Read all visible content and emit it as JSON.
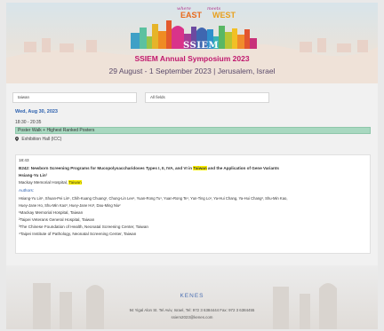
{
  "banner": {
    "where": "where",
    "meets": "meets",
    "east": "EAST",
    "west": "WEST",
    "logo": "SSIEM",
    "title": "SSIEM Annual Symposium 2023",
    "dates": "29 August - 1 September 2023 | Jerusalem, Israel"
  },
  "search": {
    "keyword_value": "taiwan",
    "filter_value": "All fields"
  },
  "session": {
    "date": "Wed, Aug 30, 2023",
    "time": "18:30 - 20:35",
    "title": "Poster Walk + Highest Ranked Posters",
    "location": "Exhibition Hall (ICC)"
  },
  "abstract": {
    "time": "18:43",
    "title_pre": "B242: Newborn Screening Programs for Mucopolysaccharidoses Types I, II, IVA, and VI in ",
    "title_hl": "Taiwan",
    "title_post": " and the Application of Gene Variants",
    "presenter": "Hsiang-Yu Lin¹",
    "affiliation_pre": "Mackay Memorial Hospital, ",
    "affiliation_hl": "Taiwan",
    "authors_label": "Authors:",
    "authors_line1": "Hsiang-Yu Lin¹, Shuan-Pei Lin¹, Chih-Kuang Chuang¹, Chung-Lin Lee¹, Yuan-Rong Tu¹, Yuan-Rong Te¹, Yun-Ting Lo¹, Ya-Hui Chang, Ya-Hui Chang², Shu-Min Kao,",
    "authors_line2": "Huey-Jane Ho, Shu-Min Kao³, Huey-Jane Ho³, Dau-Ming Niu²",
    "aff1": "¹Mackay Memorial Hospital, Taiwan",
    "aff2": "²Taipei Veterans General Hospital, Taiwan",
    "aff3": "³The Chinese Foundation of Health, Neonatal Screening Center, Taiwan",
    "aff4": "⁴Taipei Institute of Pathology, Neonatal Screening Center, Taiwan"
  },
  "footer": {
    "organizer": "KENES",
    "address": "94 Yigal Alon St. Tel Aviv, Israel, Tel: 972 3 6384444 Fax: 972 3 6384455",
    "email": "ssiem2023@kenes.com"
  },
  "colors": {
    "title_magenta": "#c0186e",
    "session_green": "#a8d8c0",
    "date_blue": "#2a5fae",
    "highlight": "#fff200"
  }
}
